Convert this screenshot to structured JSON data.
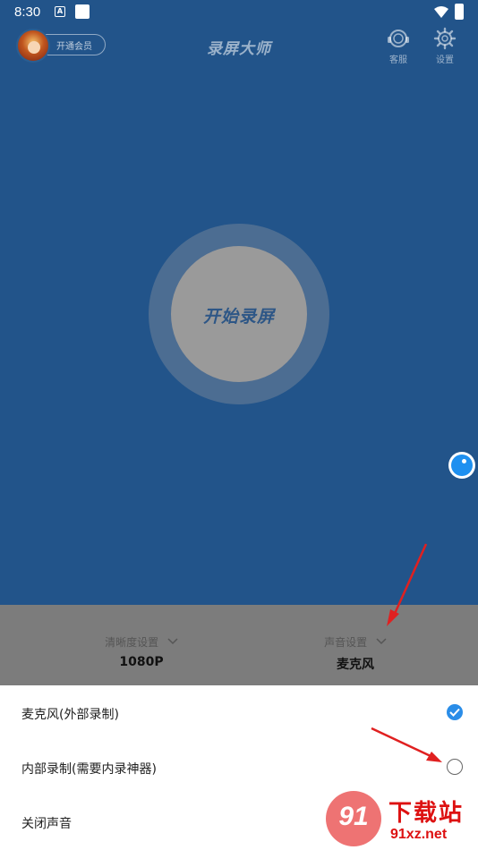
{
  "status_bar": {
    "time": "8:30",
    "notif_icon": "A"
  },
  "header": {
    "vip_label": "开通会员",
    "title": "录屏大师",
    "support_label": "客服",
    "settings_label": "设置"
  },
  "record": {
    "label": "开始录屏"
  },
  "settings": {
    "quality_title": "清晰度设置",
    "quality_value": "1080P",
    "audio_title": "声音设置",
    "audio_value": "麦克风"
  },
  "audio_options": [
    {
      "label": "麦克风(外部录制)",
      "selected": true
    },
    {
      "label": "内部录制(需要内录神器)",
      "selected": false
    },
    {
      "label": "关闭声音",
      "selected": false
    }
  ],
  "watermark": {
    "logo": "91",
    "text": "下载站",
    "url": "91xz.net"
  },
  "colors": {
    "background": "#22548a",
    "accent": "#2a8de8",
    "annotation": "#e02020"
  }
}
